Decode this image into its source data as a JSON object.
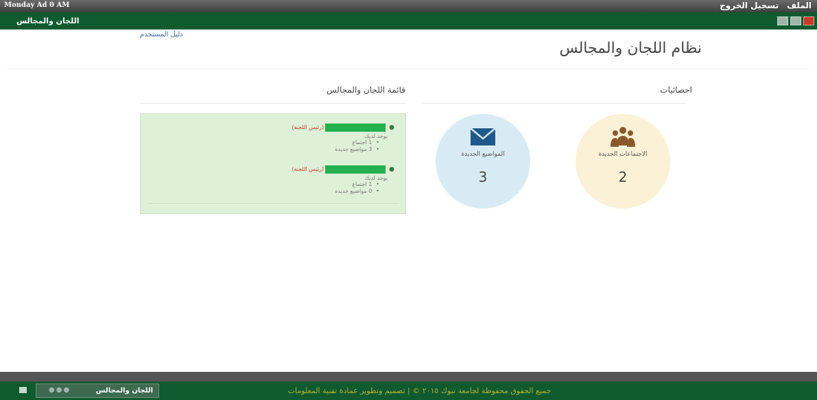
{
  "topbar": {
    "date": "Monday Ad 0 AM",
    "menu": [
      "الملف",
      "تسجيل الخروج"
    ]
  },
  "greenbar": {
    "app_name": "اللجان والمجالس"
  },
  "header": {
    "user_guide": "دليل المستخدم",
    "title": "نظام اللجان والمجالس"
  },
  "stats": {
    "title": "احصائيات",
    "new_meetings": {
      "label": "الاجتماعات الجديدة",
      "count": "2",
      "icon": "group-icon",
      "color": "#fbf1d7"
    },
    "new_topics": {
      "label": "المواضيع الجديدة",
      "count": "3",
      "icon": "envelope-icon",
      "color": "#d8ebf5"
    }
  },
  "committees": {
    "title": "قائمة اللجان والمجالس",
    "items": [
      {
        "role": "(رئيس اللجنة)",
        "sub": "يوجد لديك",
        "bullets": [
          "1 اجتماع",
          "3 مواضيع جديدة"
        ]
      },
      {
        "role": "(رئيس اللجنة)",
        "sub": "يوجد لديك",
        "bullets": [
          "1 اجتماع",
          "0 مواضيع جديدة"
        ]
      }
    ]
  },
  "footer": {
    "text": "جميع الحقوق محفوظة لجامعة تبوك ٢٠١٥ © | تصميم وتطوير عمادة تقنية المعلومات",
    "taskbar_label": "اللجان والمجالس"
  }
}
